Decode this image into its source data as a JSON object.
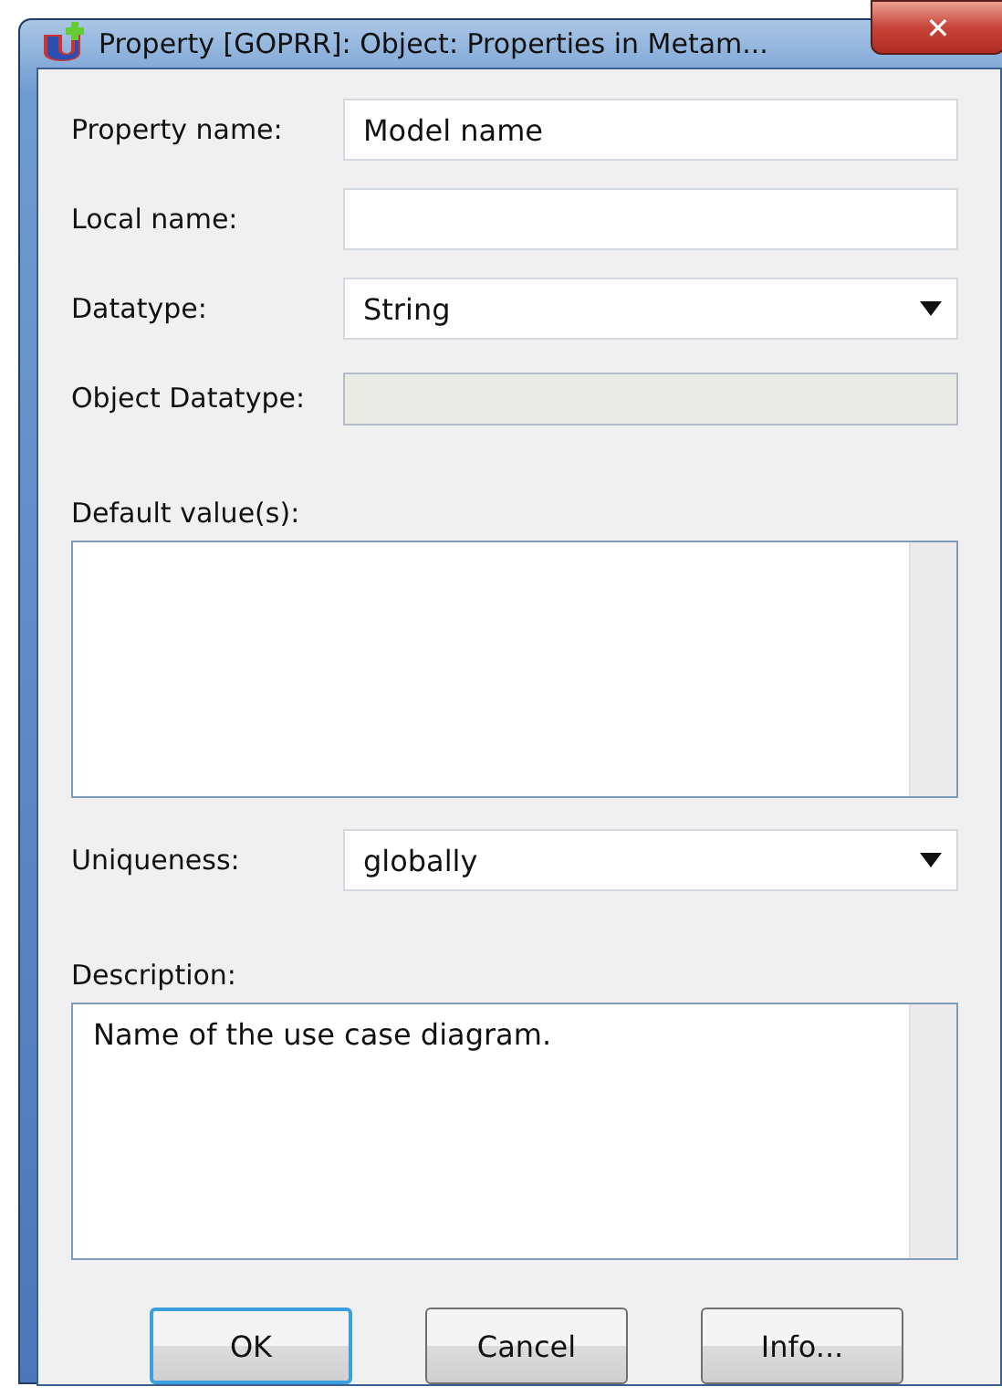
{
  "window": {
    "title": "Property [GOPRR]: Object: Properties in Metam...",
    "close": "✕"
  },
  "fields": [
    {
      "kind": "text",
      "label": "Property name:",
      "value": "Model name"
    },
    {
      "kind": "text",
      "label": "Local name:"
    },
    {
      "kind": "dropdown",
      "label": "Datatype:",
      "value": "String"
    },
    {
      "kind": "disabled",
      "label": "Object Datatype:"
    },
    {
      "kind": "textarea",
      "label": "Default value(s):"
    },
    {
      "kind": "dropdown",
      "label": "Uniqueness:",
      "value": "globally"
    },
    {
      "kind": "textarea",
      "label": "Description:",
      "value": "Name of the use case diagram."
    }
  ],
  "buttons": [
    {
      "label": "OK",
      "focused": true
    },
    {
      "label": "Cancel",
      "focused": false
    },
    {
      "label": "Info...",
      "focused": false
    }
  ]
}
